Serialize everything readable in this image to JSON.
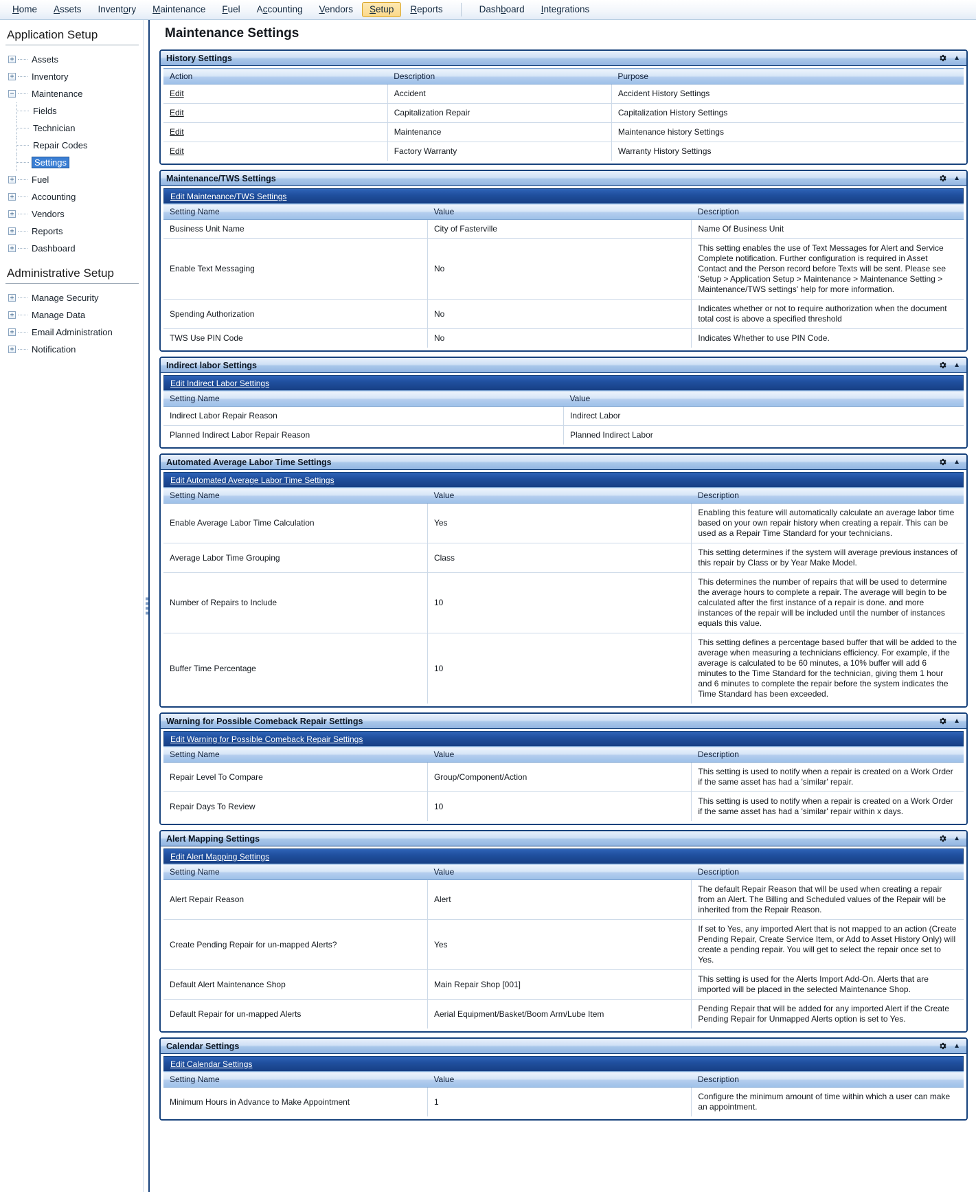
{
  "menubar": {
    "items": [
      {
        "label": "Home",
        "accel": "H",
        "active": false
      },
      {
        "label": "Assets",
        "accel": "A",
        "active": false
      },
      {
        "label": "Inventory",
        "accel": "o",
        "active": false
      },
      {
        "label": "Maintenance",
        "accel": "M",
        "active": false
      },
      {
        "label": "Fuel",
        "accel": "F",
        "active": false
      },
      {
        "label": "Accounting",
        "accel": "c",
        "active": false
      },
      {
        "label": "Vendors",
        "accel": "V",
        "active": false
      },
      {
        "label": "Setup",
        "accel": "S",
        "active": true
      },
      {
        "label": "Reports",
        "accel": "R",
        "active": false
      },
      {
        "separator": true
      },
      {
        "label": "Dashboard",
        "accel": "b",
        "active": false
      },
      {
        "label": "Integrations",
        "accel": "I",
        "active": false
      }
    ]
  },
  "sidebar": {
    "application_setup_heading": "Application Setup",
    "administrative_setup_heading": "Administrative Setup",
    "application_tree": [
      {
        "label": "Assets",
        "state": "collapsed",
        "level": 0
      },
      {
        "label": "Inventory",
        "state": "collapsed",
        "level": 0
      },
      {
        "label": "Maintenance",
        "state": "expanded",
        "level": 0
      },
      {
        "label": "Fields",
        "state": "leaf",
        "level": 1
      },
      {
        "label": "Technician",
        "state": "leaf",
        "level": 1
      },
      {
        "label": "Repair Codes",
        "state": "leaf",
        "level": 1
      },
      {
        "label": "Settings",
        "state": "leaf",
        "level": 1,
        "selected": true
      },
      {
        "label": "Fuel",
        "state": "collapsed",
        "level": 0
      },
      {
        "label": "Accounting",
        "state": "collapsed",
        "level": 0
      },
      {
        "label": "Vendors",
        "state": "collapsed",
        "level": 0
      },
      {
        "label": "Reports",
        "state": "collapsed",
        "level": 0
      },
      {
        "label": "Dashboard",
        "state": "collapsed",
        "level": 0
      }
    ],
    "administrative_tree": [
      {
        "label": "Manage Security",
        "state": "collapsed",
        "level": 0
      },
      {
        "label": "Manage Data",
        "state": "collapsed",
        "level": 0
      },
      {
        "label": "Email Administration",
        "state": "collapsed",
        "level": 0
      },
      {
        "label": "Notification",
        "state": "collapsed",
        "level": 0
      }
    ]
  },
  "main": {
    "page_title": "Maintenance Settings",
    "panels": [
      {
        "id": "history-settings",
        "title": "History Settings",
        "gear_icon": "gear-icon",
        "collapse_icon": "chevron-up-icon",
        "edit_link": null,
        "columns": [
          "Action",
          "Description",
          "Purpose"
        ],
        "col_widths": [
          "28%",
          "28%",
          "44%"
        ],
        "rows": [
          {
            "action": "Edit",
            "description": "Accident",
            "purpose": "Accident History Settings"
          },
          {
            "action": "Edit",
            "description": "Capitalization Repair",
            "purpose": "Capitalization History Settings"
          },
          {
            "action": "Edit",
            "description": "Maintenance",
            "purpose": "Maintenance history Settings"
          },
          {
            "action": "Edit",
            "description": "Factory Warranty",
            "purpose": "Warranty History Settings"
          }
        ]
      },
      {
        "id": "maintenance-tws-settings",
        "title": "Maintenance/TWS Settings",
        "gear_icon": "gear-icon",
        "collapse_icon": "chevron-up-icon",
        "edit_link": "Edit Maintenance/TWS Settings",
        "columns": [
          "Setting Name",
          "Value",
          "Description"
        ],
        "col_widths": [
          "33%",
          "33%",
          "34%"
        ],
        "rows": [
          {
            "name": "Business Unit Name",
            "value": "City of Fasterville",
            "description": "Name Of Business Unit"
          },
          {
            "name": "Enable Text Messaging",
            "value": "No",
            "description": "This setting enables the use of Text Messages for Alert and Service Complete notification. Further configuration is required in Asset Contact and the Person record before Texts will be sent. Please see 'Setup > Application Setup > Maintenance > Maintenance Setting > Maintenance/TWS settings' help for more information."
          },
          {
            "name": "Spending Authorization",
            "value": "No",
            "description": "Indicates whether or not to require authorization when the document total cost is above a specified threshold"
          },
          {
            "name": "TWS Use PIN Code",
            "value": "No",
            "description": "Indicates Whether to use PIN Code."
          }
        ]
      },
      {
        "id": "indirect-labor-settings",
        "title": "Indirect labor Settings",
        "gear_icon": "gear-icon",
        "collapse_icon": "chevron-up-icon",
        "edit_link": "Edit Indirect Labor Settings",
        "columns": [
          "Setting Name",
          "Value"
        ],
        "col_widths": [
          "50%",
          "50%"
        ],
        "rows": [
          {
            "name": "Indirect Labor Repair Reason",
            "value": "Indirect Labor"
          },
          {
            "name": "Planned Indirect Labor Repair Reason",
            "value": "Planned Indirect Labor"
          }
        ]
      },
      {
        "id": "automated-average-labor-time-settings",
        "title": "Automated Average Labor Time Settings",
        "gear_icon": "gear-icon",
        "collapse_icon": "chevron-up-icon",
        "edit_link": "Edit Automated Average Labor Time Settings",
        "columns": [
          "Setting Name",
          "Value",
          "Description"
        ],
        "col_widths": [
          "33%",
          "33%",
          "34%"
        ],
        "rows": [
          {
            "name": "Enable Average Labor Time Calculation",
            "value": "Yes",
            "description": "Enabling this feature will automatically calculate an average labor time based on your own repair history when creating a repair. This can be used as a Repair Time Standard for your technicians."
          },
          {
            "name": "Average Labor Time Grouping",
            "value": "Class",
            "description": "This setting determines if the system will average previous instances of this repair by Class or by Year Make Model."
          },
          {
            "name": "Number of Repairs to Include",
            "value": "10",
            "description": "This determines the number of repairs that will be used to determine the average hours to complete a repair. The average will begin to be calculated after the first instance of a repair is done. and more instances of the repair will be included until the number of instances equals this value."
          },
          {
            "name": "Buffer Time Percentage",
            "value": "10",
            "description": "This setting defines a percentage based buffer that will be added to the average when measuring a technicians efficiency. For example, if the average is calculated to be 60 minutes, a 10% buffer will add 6 minutes to the Time Standard for the technician, giving them 1 hour and 6 minutes to complete the repair before the system indicates the Time Standard has been exceeded."
          }
        ]
      },
      {
        "id": "warning-comeback-repair-settings",
        "title": "Warning for Possible Comeback Repair Settings",
        "gear_icon": "gear-icon",
        "collapse_icon": "chevron-up-icon",
        "edit_link": "Edit Warning for Possible Comeback Repair Settings",
        "columns": [
          "Setting Name",
          "Value",
          "Description"
        ],
        "col_widths": [
          "33%",
          "33%",
          "34%"
        ],
        "rows": [
          {
            "name": "Repair Level To Compare",
            "value": "Group/Component/Action",
            "description": "This setting is used to notify when a repair is created on a Work Order if the same asset has had a 'similar' repair."
          },
          {
            "name": "Repair Days To Review",
            "value": "10",
            "description": "This setting is used to notify when a repair is created on a Work Order if the same asset has had a 'similar' repair within x days."
          }
        ]
      },
      {
        "id": "alert-mapping-settings",
        "title": "Alert Mapping Settings",
        "gear_icon": "gear-icon",
        "collapse_icon": "chevron-up-icon",
        "edit_link": "Edit Alert Mapping Settings",
        "columns": [
          "Setting Name",
          "Value",
          "Description"
        ],
        "col_widths": [
          "33%",
          "33%",
          "34%"
        ],
        "rows": [
          {
            "name": "Alert Repair Reason",
            "value": "Alert",
            "description": "The default Repair Reason that will be used when creating a repair from an Alert. The Billing and Scheduled values of the Repair will be inherited from the Repair Reason."
          },
          {
            "name": "Create Pending Repair for un-mapped Alerts?",
            "value": "Yes",
            "description": "If set to Yes, any imported Alert that is not mapped to an action (Create Pending Repair, Create Service Item, or Add to Asset History Only) will create a pending repair. You will get to select the repair once set to Yes."
          },
          {
            "name": "Default Alert Maintenance Shop",
            "value": "Main Repair Shop [001]",
            "description": "This setting is used for the Alerts Import Add-On. Alerts that are imported will be placed in the selected Maintenance Shop."
          },
          {
            "name": "Default Repair for un-mapped Alerts",
            "value": "Aerial Equipment/Basket/Boom Arm/Lube Item",
            "description": "Pending Repair that will be added for any imported Alert if the Create Pending Repair for Unmapped Alerts option is set to Yes."
          }
        ]
      },
      {
        "id": "calendar-settings",
        "title": "Calendar Settings",
        "gear_icon": "gear-icon",
        "collapse_icon": "chevron-up-icon",
        "edit_link": "Edit Calendar Settings",
        "columns": [
          "Setting Name",
          "Value",
          "Description"
        ],
        "col_widths": [
          "33%",
          "33%",
          "34%"
        ],
        "rows": [
          {
            "name": "Minimum Hours in Advance to Make Appointment",
            "value": "1",
            "description": "Configure the minimum amount of time within which a user can make an appointment."
          }
        ]
      }
    ]
  },
  "colors": {
    "panel_border": "#17427c",
    "edit_bar": "#20509f",
    "selection": "#3b7fd4",
    "active_menu": "#fbd98a"
  }
}
